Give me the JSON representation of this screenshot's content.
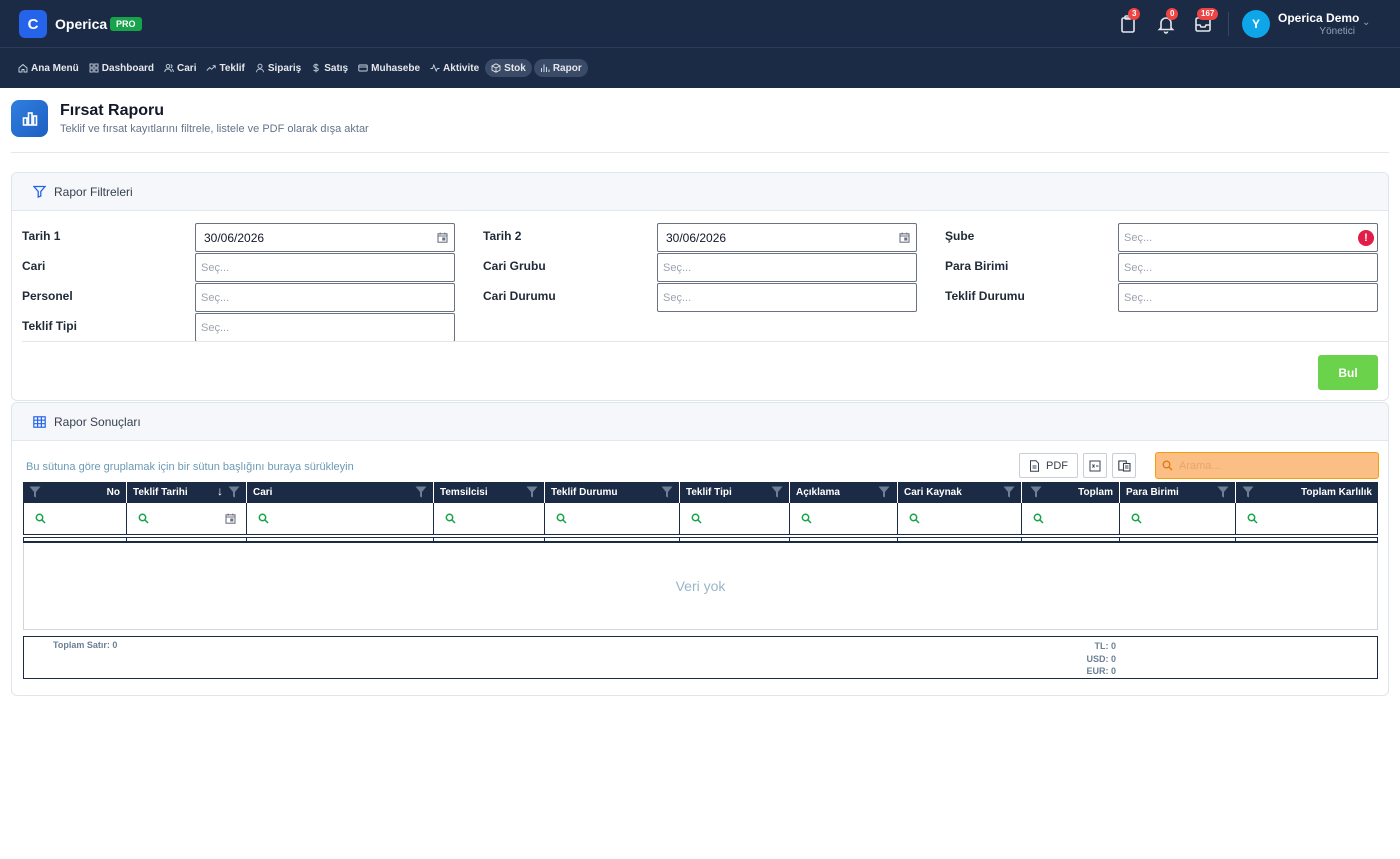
{
  "app": {
    "logo_letter": "C",
    "brand": "Operica",
    "plan_badge": "PRO"
  },
  "header": {
    "badges": {
      "tasks": "3",
      "notifications": "0",
      "inbox": "167"
    },
    "user": {
      "initial": "Y",
      "name": "Operica Demo",
      "role": "Yönetici"
    }
  },
  "nav": {
    "items": [
      {
        "label": "Ana Menü",
        "icon": "home-icon"
      },
      {
        "label": "Dashboard",
        "icon": "grid-icon"
      },
      {
        "label": "Cari",
        "icon": "users-icon"
      },
      {
        "label": "Teklif",
        "icon": "trend-icon"
      },
      {
        "label": "Sipariş",
        "icon": "user-icon"
      },
      {
        "label": "Satış",
        "icon": "dollar-icon"
      },
      {
        "label": "Muhasebe",
        "icon": "card-icon"
      },
      {
        "label": "Aktivite",
        "icon": "activity-icon"
      },
      {
        "label": "Stok",
        "icon": "box-icon"
      },
      {
        "label": "Rapor",
        "icon": "bar-chart-icon"
      }
    ]
  },
  "page": {
    "title": "Fırsat Raporu",
    "subtitle": "Teklif ve fırsat kayıtlarını filtrele, listele ve PDF olarak dışa aktar"
  },
  "filters": {
    "section_title": "Rapor Filtreleri",
    "date1_label": "Tarih 1",
    "date1_value": "30/06/2026",
    "date2_label": "Tarih 2",
    "date2_value": "30/06/2026",
    "branch_label": "Şube",
    "cari_label": "Cari",
    "cari_group_label": "Cari Grubu",
    "currency_label": "Para Birimi",
    "personnel_label": "Personel",
    "cari_status_label": "Cari Durumu",
    "offer_status_label": "Teklif Durumu",
    "offer_type_label": "Teklif Tipi",
    "select_placeholder": "Seç...",
    "find_button": "Bul"
  },
  "results": {
    "section_title": "Rapor Sonuçları",
    "group_hint": "Bu sütuna göre gruplamak için bir sütun başlığını buraya sürükleyin",
    "pdf_button": "PDF",
    "search_placeholder": "Arama...",
    "columns": [
      "No",
      "Teklif Tarihi",
      "Cari",
      "Temsilcisi",
      "Teklif Durumu",
      "Teklif Tipi",
      "Açıklama",
      "Cari Kaynak",
      "Toplam",
      "Para Birimi",
      "Toplam Karlılık"
    ],
    "empty_text": "Veri yok",
    "total_rows": "Toplam Satır: 0",
    "totals": {
      "tl": "TL: 0",
      "usd": "USD: 0",
      "eur": "EUR: 0"
    }
  }
}
